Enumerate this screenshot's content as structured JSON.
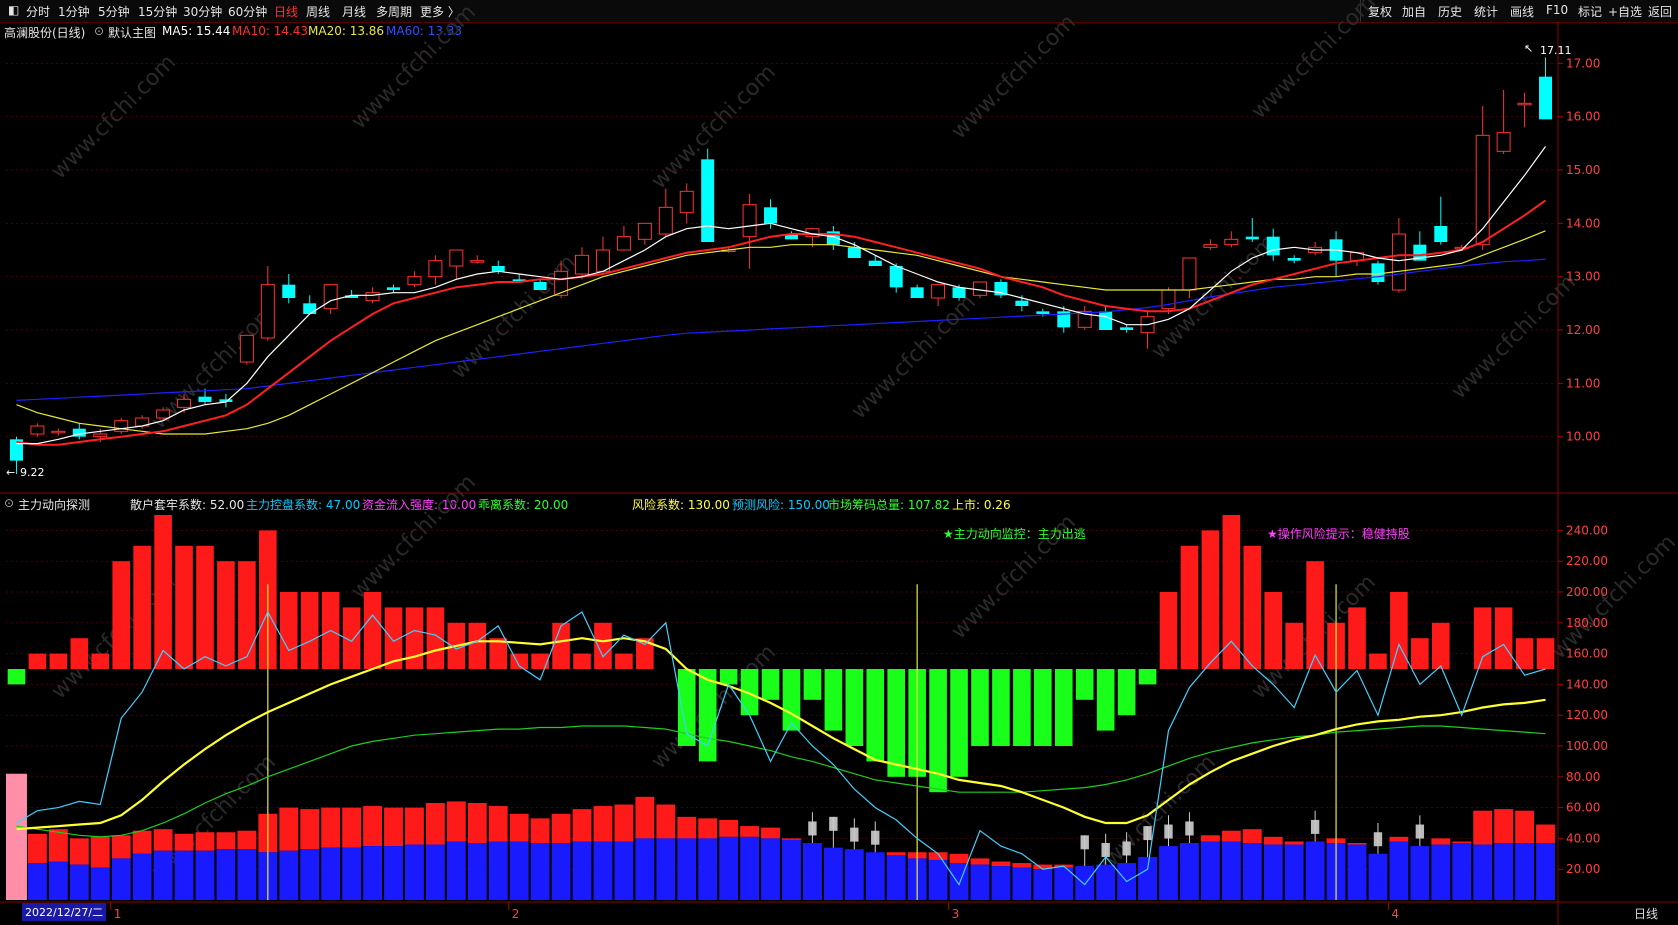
{
  "toolbar": {
    "timeframes": [
      "分时",
      "1分钟",
      "5分钟",
      "15分钟",
      "30分钟",
      "60分钟",
      "日线",
      "周线",
      "月线",
      "多周期",
      "更多 〉"
    ],
    "active": "日线",
    "right_buttons": [
      "复权",
      "加自",
      "历史",
      "统计",
      "画线",
      "F10",
      "标记",
      "+自选",
      "返回"
    ]
  },
  "main_info": {
    "stock": "高澜股份(日线)",
    "template": "默认主图",
    "ma5": "MA5: 15.44",
    "ma10": "MA10: 14.43",
    "ma20": "MA20: 13.86",
    "ma60": "MA60: 13.33"
  },
  "indicator_info": {
    "name": "主力动向探测",
    "p1": "散户套牢系数: 52.00",
    "p2": "主力控盘系数: 47.00",
    "p3": "资金流入强度: 10.00",
    "p4": "乖离系数: 20.00",
    "p5": "风险系数: 130.00",
    "p6": "预测风险: 150.00",
    "p7": "市场筹码总量: 107.82",
    "p8": "上市: 0.26"
  },
  "annotations": {
    "monitor": "★主力动向监控：主力出逃",
    "risk": "★操作风险提示：稳健持股",
    "high_label": "17.11",
    "low_label": "9.22"
  },
  "date_box": "2022/12/27/二",
  "footer": {
    "label": "日线"
  },
  "month_labels": [
    "1",
    "2",
    "3",
    "4"
  ],
  "watermark": "www.cfchi.com",
  "colors": {
    "up": "#ff3232",
    "down": "#00ffff",
    "ma5": "#ffffff",
    "ma10": "#ff2020",
    "ma20": "#e8e83a",
    "ma60": "#2020ff"
  },
  "chart_data": [
    {
      "type": "candlestick",
      "title": "高澜股份(日线)",
      "ylim": [
        9.0,
        17.4
      ],
      "yticks": [
        10.0,
        11.0,
        12.0,
        13.0,
        14.0,
        15.0,
        16.0,
        17.0
      ],
      "candles": [
        [
          9.95,
          10.0,
          9.3,
          9.55
        ],
        [
          10.05,
          10.25,
          10.0,
          10.2
        ],
        [
          10.1,
          10.15,
          10.02,
          10.1
        ],
        [
          10.15,
          10.25,
          9.95,
          10.0
        ],
        [
          10.0,
          10.15,
          9.9,
          10.05
        ],
        [
          10.1,
          10.35,
          10.05,
          10.3
        ],
        [
          10.2,
          10.4,
          10.15,
          10.35
        ],
        [
          10.35,
          10.55,
          10.3,
          10.5
        ],
        [
          10.55,
          10.8,
          10.45,
          10.7
        ],
        [
          10.75,
          10.9,
          10.6,
          10.65
        ],
        [
          10.7,
          10.8,
          10.55,
          10.65
        ],
        [
          11.4,
          11.6,
          11.35,
          11.9
        ],
        [
          11.85,
          13.2,
          11.8,
          12.85
        ],
        [
          12.85,
          13.05,
          12.5,
          12.6
        ],
        [
          12.5,
          12.65,
          12.3,
          12.3
        ],
        [
          12.4,
          12.85,
          12.3,
          12.85
        ],
        [
          12.65,
          12.75,
          12.6,
          12.6
        ],
        [
          12.55,
          12.8,
          12.5,
          12.7
        ],
        [
          12.8,
          12.85,
          12.7,
          12.75
        ],
        [
          12.85,
          13.1,
          12.8,
          13.0
        ],
        [
          13.0,
          13.4,
          12.85,
          13.3
        ],
        [
          13.2,
          13.5,
          12.95,
          13.5
        ],
        [
          13.3,
          13.4,
          13.25,
          13.3
        ],
        [
          13.2,
          13.3,
          13.05,
          13.1
        ],
        [
          12.95,
          13.05,
          12.9,
          12.9
        ],
        [
          12.9,
          12.95,
          12.75,
          12.75
        ],
        [
          12.65,
          13.3,
          12.6,
          13.1
        ],
        [
          13.05,
          13.55,
          12.95,
          13.4
        ],
        [
          13.1,
          13.75,
          13.05,
          13.5
        ],
        [
          13.5,
          13.95,
          13.5,
          13.75
        ],
        [
          13.7,
          13.95,
          13.6,
          14.0
        ],
        [
          13.8,
          14.65,
          13.75,
          14.3
        ],
        [
          14.2,
          14.75,
          14.0,
          14.6
        ],
        [
          15.2,
          15.4,
          13.65,
          13.65
        ],
        [
          13.5,
          13.55,
          13.45,
          13.5
        ],
        [
          13.75,
          14.55,
          13.15,
          14.35
        ],
        [
          14.3,
          14.45,
          13.9,
          14.0
        ],
        [
          13.8,
          13.85,
          13.7,
          13.7
        ],
        [
          13.75,
          13.9,
          13.55,
          13.9
        ],
        [
          13.85,
          13.95,
          13.5,
          13.6
        ],
        [
          13.55,
          13.65,
          13.35,
          13.35
        ],
        [
          13.3,
          13.4,
          13.2,
          13.2
        ],
        [
          13.2,
          13.25,
          12.7,
          12.8
        ],
        [
          12.8,
          12.85,
          12.6,
          12.6
        ],
        [
          12.6,
          12.85,
          12.45,
          12.85
        ],
        [
          12.8,
          12.85,
          12.55,
          12.6
        ],
        [
          12.65,
          12.9,
          12.6,
          12.9
        ],
        [
          12.9,
          12.95,
          12.6,
          12.65
        ],
        [
          12.55,
          12.65,
          12.35,
          12.45
        ],
        [
          12.35,
          12.4,
          12.25,
          12.3
        ],
        [
          12.35,
          12.45,
          11.95,
          12.05
        ],
        [
          12.05,
          12.45,
          12.0,
          12.35
        ],
        [
          12.35,
          12.45,
          12.0,
          12.0
        ],
        [
          12.05,
          12.1,
          11.95,
          12.0
        ],
        [
          11.95,
          12.35,
          11.65,
          12.25
        ],
        [
          12.4,
          12.8,
          12.3,
          12.75
        ],
        [
          12.75,
          13.35,
          12.6,
          13.35
        ],
        [
          13.55,
          13.7,
          13.5,
          13.6
        ],
        [
          13.6,
          13.85,
          13.55,
          13.7
        ],
        [
          13.75,
          14.1,
          13.65,
          13.7
        ],
        [
          13.75,
          13.9,
          13.3,
          13.4
        ],
        [
          13.35,
          13.4,
          13.25,
          13.3
        ],
        [
          13.45,
          13.65,
          13.4,
          13.55
        ],
        [
          13.7,
          13.85,
          13.0,
          13.3
        ],
        [
          13.3,
          13.45,
          13.2,
          13.45
        ],
        [
          13.25,
          13.3,
          12.85,
          12.9
        ],
        [
          12.75,
          14.1,
          12.7,
          13.8
        ],
        [
          13.6,
          13.85,
          13.3,
          13.3
        ],
        [
          13.95,
          14.5,
          13.6,
          13.65
        ],
        [
          13.55,
          13.6,
          13.55,
          13.55
        ],
        [
          13.6,
          16.2,
          13.5,
          15.65
        ],
        [
          15.35,
          16.5,
          15.3,
          15.7
        ],
        [
          16.25,
          16.45,
          15.8,
          16.25
        ],
        [
          16.75,
          17.11,
          16.1,
          15.95
        ]
      ],
      "ma5": [
        9.87,
        9.87,
        9.95,
        10.05,
        10.1,
        10.15,
        10.2,
        10.3,
        10.5,
        10.6,
        10.65,
        11.0,
        11.5,
        11.9,
        12.3,
        12.55,
        12.65,
        12.65,
        12.7,
        12.7,
        12.8,
        12.95,
        13.05,
        13.1,
        13.05,
        13.0,
        12.95,
        13.0,
        13.1,
        13.3,
        13.5,
        13.75,
        13.9,
        13.95,
        13.9,
        13.95,
        14.0,
        13.9,
        13.8,
        13.75,
        13.6,
        13.4,
        13.2,
        13.05,
        12.9,
        12.8,
        12.75,
        12.7,
        12.6,
        12.5,
        12.4,
        12.3,
        12.25,
        12.1,
        12.1,
        12.2,
        12.4,
        12.75,
        13.1,
        13.35,
        13.5,
        13.55,
        13.5,
        13.5,
        13.45,
        13.35,
        13.3,
        13.35,
        13.4,
        13.5,
        13.9,
        14.4,
        14.9,
        15.44
      ],
      "ma10": [
        9.9,
        9.85,
        9.85,
        9.9,
        9.95,
        10.0,
        10.05,
        10.1,
        10.2,
        10.3,
        10.4,
        10.6,
        10.9,
        11.2,
        11.5,
        11.8,
        12.05,
        12.3,
        12.5,
        12.6,
        12.7,
        12.8,
        12.85,
        12.9,
        12.9,
        12.95,
        12.95,
        13.0,
        13.05,
        13.15,
        13.25,
        13.35,
        13.45,
        13.5,
        13.55,
        13.65,
        13.75,
        13.8,
        13.8,
        13.8,
        13.75,
        13.65,
        13.55,
        13.45,
        13.35,
        13.25,
        13.15,
        13.0,
        12.9,
        12.8,
        12.65,
        12.55,
        12.45,
        12.4,
        12.35,
        12.35,
        12.4,
        12.55,
        12.7,
        12.85,
        12.95,
        13.05,
        13.15,
        13.25,
        13.3,
        13.35,
        13.4,
        13.4,
        13.45,
        13.5,
        13.65,
        13.9,
        14.15,
        14.43
      ],
      "ma20": [
        10.6,
        10.45,
        10.35,
        10.25,
        10.2,
        10.15,
        10.1,
        10.05,
        10.05,
        10.05,
        10.1,
        10.15,
        10.25,
        10.4,
        10.6,
        10.8,
        11.0,
        11.2,
        11.4,
        11.6,
        11.8,
        11.95,
        12.1,
        12.25,
        12.4,
        12.55,
        12.7,
        12.85,
        13.0,
        13.1,
        13.2,
        13.3,
        13.4,
        13.45,
        13.5,
        13.55,
        13.55,
        13.6,
        13.6,
        13.6,
        13.55,
        13.5,
        13.45,
        13.4,
        13.3,
        13.2,
        13.1,
        13.0,
        12.95,
        12.9,
        12.85,
        12.8,
        12.75,
        12.75,
        12.75,
        12.75,
        12.75,
        12.8,
        12.85,
        12.9,
        12.95,
        12.95,
        13.0,
        13.0,
        13.05,
        13.05,
        13.1,
        13.15,
        13.2,
        13.25,
        13.4,
        13.55,
        13.7,
        13.86
      ],
      "ma60": [
        10.68,
        10.7,
        10.72,
        10.74,
        10.76,
        10.78,
        10.8,
        10.82,
        10.84,
        10.86,
        10.88,
        10.9,
        10.95,
        11.0,
        11.05,
        11.1,
        11.15,
        11.2,
        11.25,
        11.3,
        11.35,
        11.4,
        11.45,
        11.5,
        11.55,
        11.6,
        11.65,
        11.7,
        11.75,
        11.8,
        11.85,
        11.9,
        11.94,
        11.96,
        11.98,
        12.0,
        12.02,
        12.04,
        12.06,
        12.08,
        12.1,
        12.12,
        12.14,
        12.16,
        12.18,
        12.2,
        12.22,
        12.24,
        12.26,
        12.28,
        12.3,
        12.32,
        12.34,
        12.38,
        12.42,
        12.48,
        12.55,
        12.62,
        12.68,
        12.74,
        12.8,
        12.84,
        12.88,
        12.92,
        12.96,
        13.0,
        13.05,
        13.1,
        13.15,
        13.2,
        13.24,
        13.28,
        13.3,
        13.33
      ]
    },
    {
      "type": "bar",
      "title": "主力动向探测",
      "ylim": [
        0,
        250
      ],
      "yticks": [
        20,
        40,
        60,
        80,
        100,
        120,
        140,
        160,
        180,
        200,
        220,
        240
      ],
      "baseline": 150,
      "top_bars": [
        140,
        160,
        160,
        170,
        160,
        220,
        230,
        250,
        230,
        230,
        220,
        220,
        240,
        200,
        200,
        200,
        190,
        200,
        190,
        190,
        190,
        180,
        180,
        170,
        160,
        160,
        180,
        160,
        180,
        160,
        170,
        150,
        100,
        90,
        140,
        120,
        130,
        110,
        130,
        110,
        100,
        90,
        80,
        80,
        70,
        80,
        100,
        100,
        100,
        100,
        100,
        130,
        110,
        120,
        140,
        200,
        230,
        240,
        250,
        230,
        200,
        180,
        220,
        180,
        190,
        160,
        200,
        170,
        180,
        150,
        190,
        190,
        170,
        170
      ],
      "bottom_red": [
        47,
        43,
        46,
        40,
        41,
        42,
        45,
        46,
        43,
        44,
        44,
        45,
        56,
        60,
        59,
        60,
        60,
        61,
        60,
        60,
        63,
        64,
        63,
        61,
        56,
        53,
        56,
        59,
        61,
        62,
        67,
        62,
        54,
        53,
        52,
        48,
        47,
        40,
        36,
        33,
        31,
        30,
        31,
        31,
        31,
        30,
        27,
        25,
        24,
        23,
        23,
        22,
        23,
        22,
        21,
        26,
        36,
        42,
        45,
        46,
        41,
        38,
        38,
        40,
        37,
        30,
        41,
        35,
        40,
        38,
        58,
        59,
        58,
        49
      ],
      "bottom_blue": [
        23,
        24,
        25,
        23,
        21,
        27,
        30,
        32,
        32,
        32,
        33,
        33,
        31,
        32,
        33,
        34,
        34,
        35,
        35,
        36,
        36,
        38,
        37,
        38,
        38,
        37,
        37,
        38,
        38,
        38,
        40,
        40,
        40,
        40,
        41,
        41,
        40,
        39,
        37,
        34,
        33,
        31,
        29,
        27,
        26,
        24,
        23,
        22,
        21,
        20,
        21,
        22,
        23,
        24,
        28,
        35,
        37,
        38,
        38,
        37,
        36,
        36,
        38,
        37,
        36,
        30,
        38,
        35,
        36,
        37,
        36,
        37,
        37,
        37
      ],
      "cyan_line": [
        50,
        58,
        60,
        64,
        62,
        118,
        135,
        162,
        150,
        158,
        152,
        158,
        187,
        162,
        168,
        175,
        168,
        185,
        168,
        175,
        172,
        163,
        168,
        178,
        152,
        143,
        178,
        187,
        158,
        172,
        166,
        180,
        108,
        100,
        140,
        120,
        90,
        115,
        100,
        88,
        72,
        60,
        52,
        40,
        30,
        10,
        45,
        35,
        30,
        20,
        22,
        10,
        28,
        12,
        20,
        110,
        138,
        154,
        168,
        152,
        140,
        125,
        159,
        135,
        149,
        120,
        166,
        140,
        152,
        120,
        158,
        166,
        146,
        150
      ],
      "yellow_line": [
        46,
        47,
        48,
        49,
        50,
        55,
        65,
        77,
        88,
        98,
        107,
        115,
        122,
        128,
        134,
        140,
        145,
        150,
        155,
        158,
        162,
        165,
        168,
        168,
        167,
        166,
        168,
        170,
        168,
        170,
        168,
        163,
        150,
        143,
        139,
        134,
        128,
        121,
        113,
        105,
        98,
        91,
        88,
        85,
        82,
        78,
        76,
        74,
        70,
        65,
        60,
        54,
        50,
        50,
        55,
        65,
        75,
        83,
        90,
        95,
        100,
        104,
        107,
        111,
        114,
        116,
        117,
        119,
        120,
        122,
        125,
        127,
        128,
        130
      ],
      "green_line": [
        48,
        46,
        44,
        42,
        41,
        42,
        45,
        50,
        56,
        63,
        69,
        74,
        80,
        85,
        90,
        95,
        100,
        103,
        105,
        107,
        108,
        109,
        110,
        111,
        111,
        112,
        112,
        113,
        113,
        113,
        112,
        111,
        108,
        105,
        103,
        100,
        97,
        93,
        90,
        86,
        82,
        78,
        76,
        74,
        72,
        70,
        70,
        70,
        70,
        71,
        72,
        73,
        75,
        78,
        82,
        87,
        92,
        96,
        99,
        102,
        104,
        106,
        107,
        109,
        110,
        111,
        112,
        113,
        113,
        112,
        111,
        110,
        109,
        108
      ],
      "vlines_at": [
        12,
        43,
        63
      ]
    }
  ]
}
